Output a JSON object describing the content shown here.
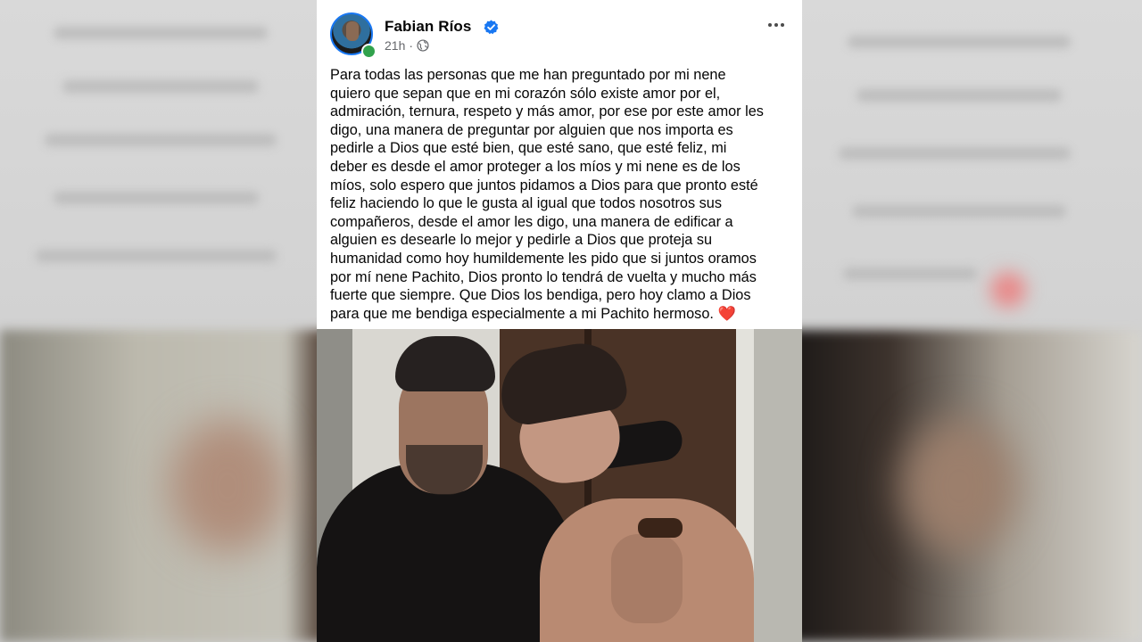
{
  "post": {
    "author": "Fabian Ríos",
    "time": "21h",
    "dot": "·",
    "audience_icon": "globe-icon",
    "verified_icon": "verified-badge-icon",
    "more_icon": "more-options-icon",
    "text_lines": [
      "Para todas las personas que me han preguntado por mi nene",
      "quiero que sepan que en mi corazón sólo existe amor por el,",
      "admiración, ternura, respeto y más amor, por ese por este amor les",
      "digo, una manera de preguntar por alguien que nos importa es",
      "pedirle a Dios que esté bien, que esté sano, que esté feliz, mi",
      "deber es desde el amor proteger a los míos y mi nene es de los",
      "míos, solo espero que juntos pidamos a Dios para que pronto esté",
      "feliz haciendo lo que le gusta al igual que todos nosotros sus",
      "compañeros, desde el amor les digo, una manera de edificar a",
      "alguien es desearle lo mejor y pedirle a Dios que proteja su",
      "humanidad como hoy humildemente les pido que si juntos oramos",
      "por mí nene Pachito, Dios pronto lo tendrá de vuelta y mucho más",
      "fuerte que siempre. Que Dios los bendiga, pero hoy clamo a Dios",
      "para que me bendiga especialmente a mi Pachito hermoso."
    ],
    "emoji": "❤️"
  },
  "colors": {
    "accent": "#1877f2",
    "online": "#31a24c",
    "heart": "#e41e3f",
    "meta": "#65676b"
  }
}
